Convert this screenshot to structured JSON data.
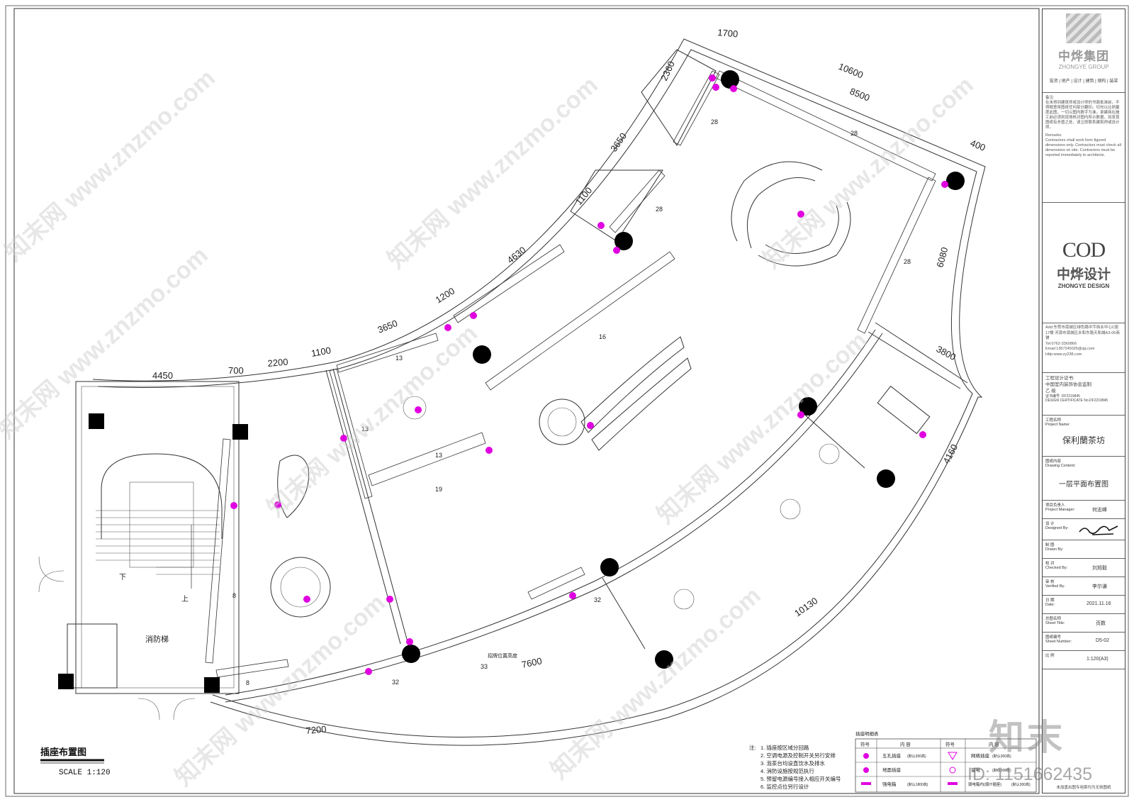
{
  "drawing": {
    "title": "插座布置图",
    "scale": "SCALE 1:120",
    "rooms": {
      "stair": "消防梯",
      "down": "下",
      "up": "上"
    },
    "annotation": "招牌位置高度",
    "dimensions": [
      "1700",
      "10600",
      "8500",
      "400",
      "2360",
      "3650",
      "1100",
      "4630",
      "1200",
      "3650",
      "1100",
      "2200",
      "700",
      "4450",
      "6080",
      "3800",
      "4160",
      "10130",
      "7600",
      "7200"
    ],
    "circuit_tags": [
      "28",
      "28",
      "28",
      "28",
      "16",
      "13",
      "13",
      "13",
      "19",
      "8",
      "8",
      "32",
      "32",
      "33"
    ]
  },
  "notes": {
    "label": "注:",
    "items": [
      "1. 插座按区域分回路",
      "2. 空调电源及控制开关另行安排",
      "3. 泡茶台均设直饮水及排水",
      "4. 消防设施按规范执行",
      "5. 预留电源编号接入相应开关编号",
      "6. 监控点位另行设计"
    ]
  },
  "legend": {
    "title": "插座明细表",
    "headers": [
      "符号",
      "内 容",
      "符号",
      "内 容"
    ],
    "rows": [
      {
        "left": "五孔插座",
        "left_note": "(默认300高)",
        "right": "网络插座",
        "right_note": "(默认300高)"
      },
      {
        "left": "地面插座",
        "left_note": "",
        "right": "留电",
        "right_note": "(默认300高)"
      },
      {
        "left": "强电箱",
        "left_note": "(默认1800高)",
        "right": "弱电箱内(弱IT插座)",
        "right_note": "(默认300高)"
      }
    ]
  },
  "title_block": {
    "company_cn": "中烨集团",
    "company_en": "ZHONGYE GROUP",
    "services": "投资 | 地产 | 设计 | 建筑 | 钢构 | 装梁",
    "remarks_cn_label": "备注:",
    "remarks_cn": "在未得到建筑师或设计师的书面批准前，不得随意将图纸任何部分翻印。切勿以比例量度此图，一切以图内数字为准。承建商在施工前必须到现场核对图内所示数据，如发现图纸有矛盾之处，请立即联系建筑师或设计师。",
    "remarks_en_label": "Remarks:",
    "remarks_en": "Contractors shall work form figured dimensions only. Contractors must check all dimensions on site. Contractors must be reported immediately to architects.",
    "design_logo": "COD",
    "design_cn": "中烨设计",
    "design_en": "ZHONGYE DESIGN",
    "address": "Add:东莞市南城区绿色路中宇商业中心C座17楼 河源市源城区永和东路天和城A3-06商铺",
    "tel": "Tel:0762-3360866",
    "email": "Email:1367245026@qq.com",
    "http": "Http:www.zy238.com",
    "cert_label": "工程设计证书:",
    "cert_org": "中国室内装饰协会监制",
    "cert_grade": "乙 级",
    "cert_no": "证书编号: DF2219845",
    "cert_en": "DESIGN CERTIFICATE No.DF2219845",
    "project_label": "工程名称",
    "project_label_en": "Project Name:",
    "project_name": "保利蘭茶坊",
    "drawing_label": "图纸内容",
    "drawing_label_en": "Drawing Content:",
    "drawing_name": "一层平面布置图",
    "manager_label": "项目负责人",
    "manager_label_en": "Project Manager:",
    "manager": "何志峰",
    "designed_label": "设 计",
    "designed_label_en": "Designed By:",
    "drawn_label": "制 图",
    "drawn_label_en": "Drawn By:",
    "checked_label": "校 对",
    "checked_label_en": "Checked By:",
    "checked": "刘旭毅",
    "verified_label": "审 核",
    "verified_label_en": "Verified By:",
    "verified": "李尔谦",
    "date_label": "日 期",
    "date_label_en": "Date:",
    "date": "2021.11.16",
    "sheet_title_label": "总图名称",
    "sheet_title_label_en": "Sheet Title:",
    "sheet_title": "页数",
    "sheet_no_label": "图纸编号",
    "sheet_no_label_en": "Sheet Number:",
    "sheet_no": "D5-02",
    "scale_label": "比 例",
    "scale": "1:120(A3)",
    "footer": "未加盖出图专用章均为无效图纸"
  },
  "watermark": {
    "text": "知末网 www.znzmo.com",
    "brand": "知末",
    "id": "ID: 1151662435"
  }
}
